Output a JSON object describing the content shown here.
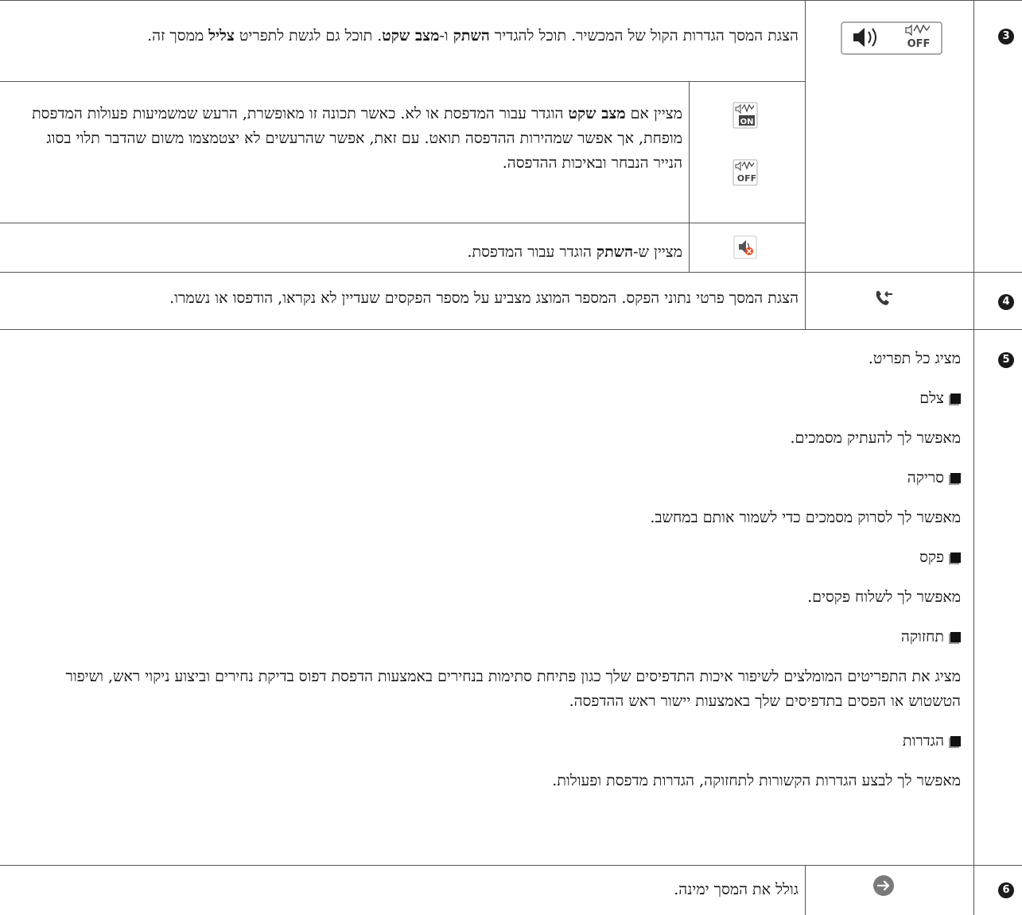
{
  "rows": [
    {
      "number": "3",
      "icon": "volume-and-quiet-mode-icons",
      "text_parts": [
        "הצגת המסך הגדרות הקול של המכשיר. תוכל להגדיר ",
        "השתק",
        " ו-",
        "מצב שקט",
        ". תוכל גם לגשת לתפריט ",
        "צליל",
        " ממסך זה."
      ],
      "sub_rows": [
        {
          "icons": [
            "quiet-mode-on-icon",
            "quiet-mode-off-icon"
          ],
          "text_parts": [
            "מציין אם ",
            "מצב שקט",
            " הוגדר עבור המדפסת או לא. כאשר תכונה זו מאופשרת, הרעש שמשמיעות פעולות המדפסת מופחת, אך אפשר שמהירות ההדפסה תואט. עם זאת, אפשר שהרעשים לא יצטמצמו משום שהדבר תלוי בסוג הנייר הנבחר ובאיכות ההדפסה."
          ]
        },
        {
          "icons": [
            "mute-icon"
          ],
          "text_parts": [
            "מציין ש-",
            "השתק",
            " הוגדר עבור המדפסת."
          ]
        }
      ]
    },
    {
      "number": "4",
      "icon": "fax-data-icon",
      "text": "הצגת המסך פרטי נתוני הפקס. המספר המוצג מצביע על מספר הפקסים שעדיין לא נקראו, הודפסו או נשמרו."
    },
    {
      "number": "5",
      "intro": "מציג כל תפריט.",
      "items": [
        {
          "label": "צלם",
          "desc": "מאפשר לך להעתיק מסמכים."
        },
        {
          "label": "סריקה",
          "desc": "מאפשר לך לסרוק מסמכים כדי לשמור אותם במחשב."
        },
        {
          "label": "פקס",
          "desc": "מאפשר לך לשלוח פקסים."
        },
        {
          "label": "תחזוקה",
          "desc": "מציג את התפריטים המומלצים לשיפור איכות התדפיסים שלך כגון פתיחת סתימות בנחירים באמצעות הדפסת דפוס בדיקת נחירים וביצוע ניקוי ראש, ושיפור הטשטוש או הפסים בתדפיסים שלך באמצעות יישור ראש ההדפסה."
        },
        {
          "label": "הגדרות",
          "desc": "מאפשר לך לבצע הגדרות הקשורות לתחזוקה, הגדרות מדפסת ופעולות."
        }
      ]
    },
    {
      "number": "6",
      "icon": "scroll-right-arrow-icon",
      "text": "גולל את המסך ימינה."
    }
  ]
}
